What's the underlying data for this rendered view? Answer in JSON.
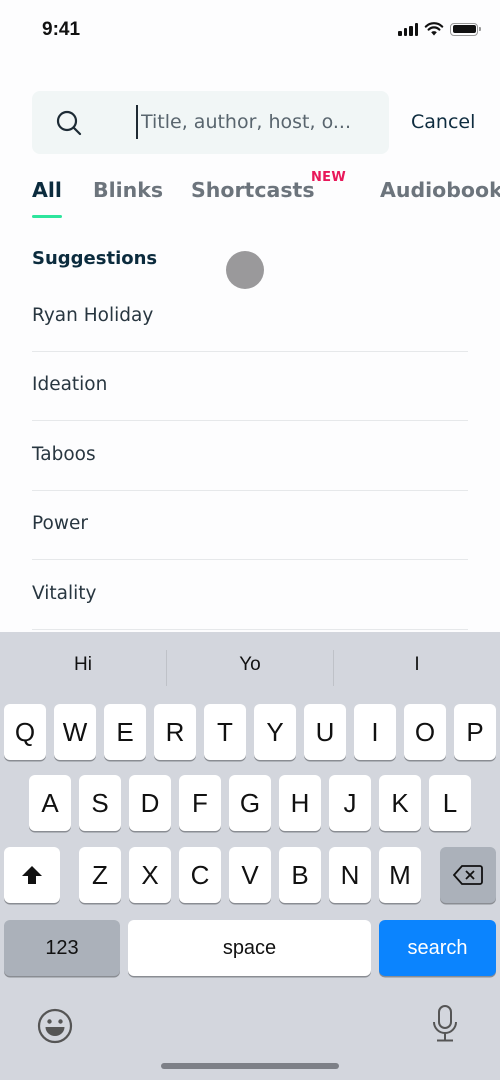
{
  "status_bar": {
    "time": "9:41"
  },
  "search": {
    "placeholder": "Title, author, host, o...",
    "value": "",
    "cancel_label": "Cancel"
  },
  "tabs": [
    {
      "label": "All",
      "active": true
    },
    {
      "label": "Blinks",
      "active": false
    },
    {
      "label": "Shortcasts",
      "active": false,
      "badge": "NEW"
    },
    {
      "label": "Audiobooks",
      "active": false
    }
  ],
  "suggestions": {
    "title": "Suggestions",
    "items": [
      "Ryan Holiday",
      "Ideation",
      "Taboos",
      "Power",
      "Vitality"
    ]
  },
  "keyboard": {
    "predictions": [
      "Hi",
      "Yo",
      "I"
    ],
    "row1": [
      "Q",
      "W",
      "E",
      "R",
      "T",
      "Y",
      "U",
      "I",
      "O",
      "P"
    ],
    "row2": [
      "A",
      "S",
      "D",
      "F",
      "G",
      "H",
      "J",
      "K",
      "L"
    ],
    "row3": [
      "Z",
      "X",
      "C",
      "V",
      "B",
      "N",
      "M"
    ],
    "numbers_label": "123",
    "space_label": "space",
    "action_label": "search",
    "action_color": "#0b84fe"
  },
  "colors": {
    "accent_underline": "#2ee59d",
    "badge": "#e8185a",
    "heading": "#0b2b3d"
  }
}
